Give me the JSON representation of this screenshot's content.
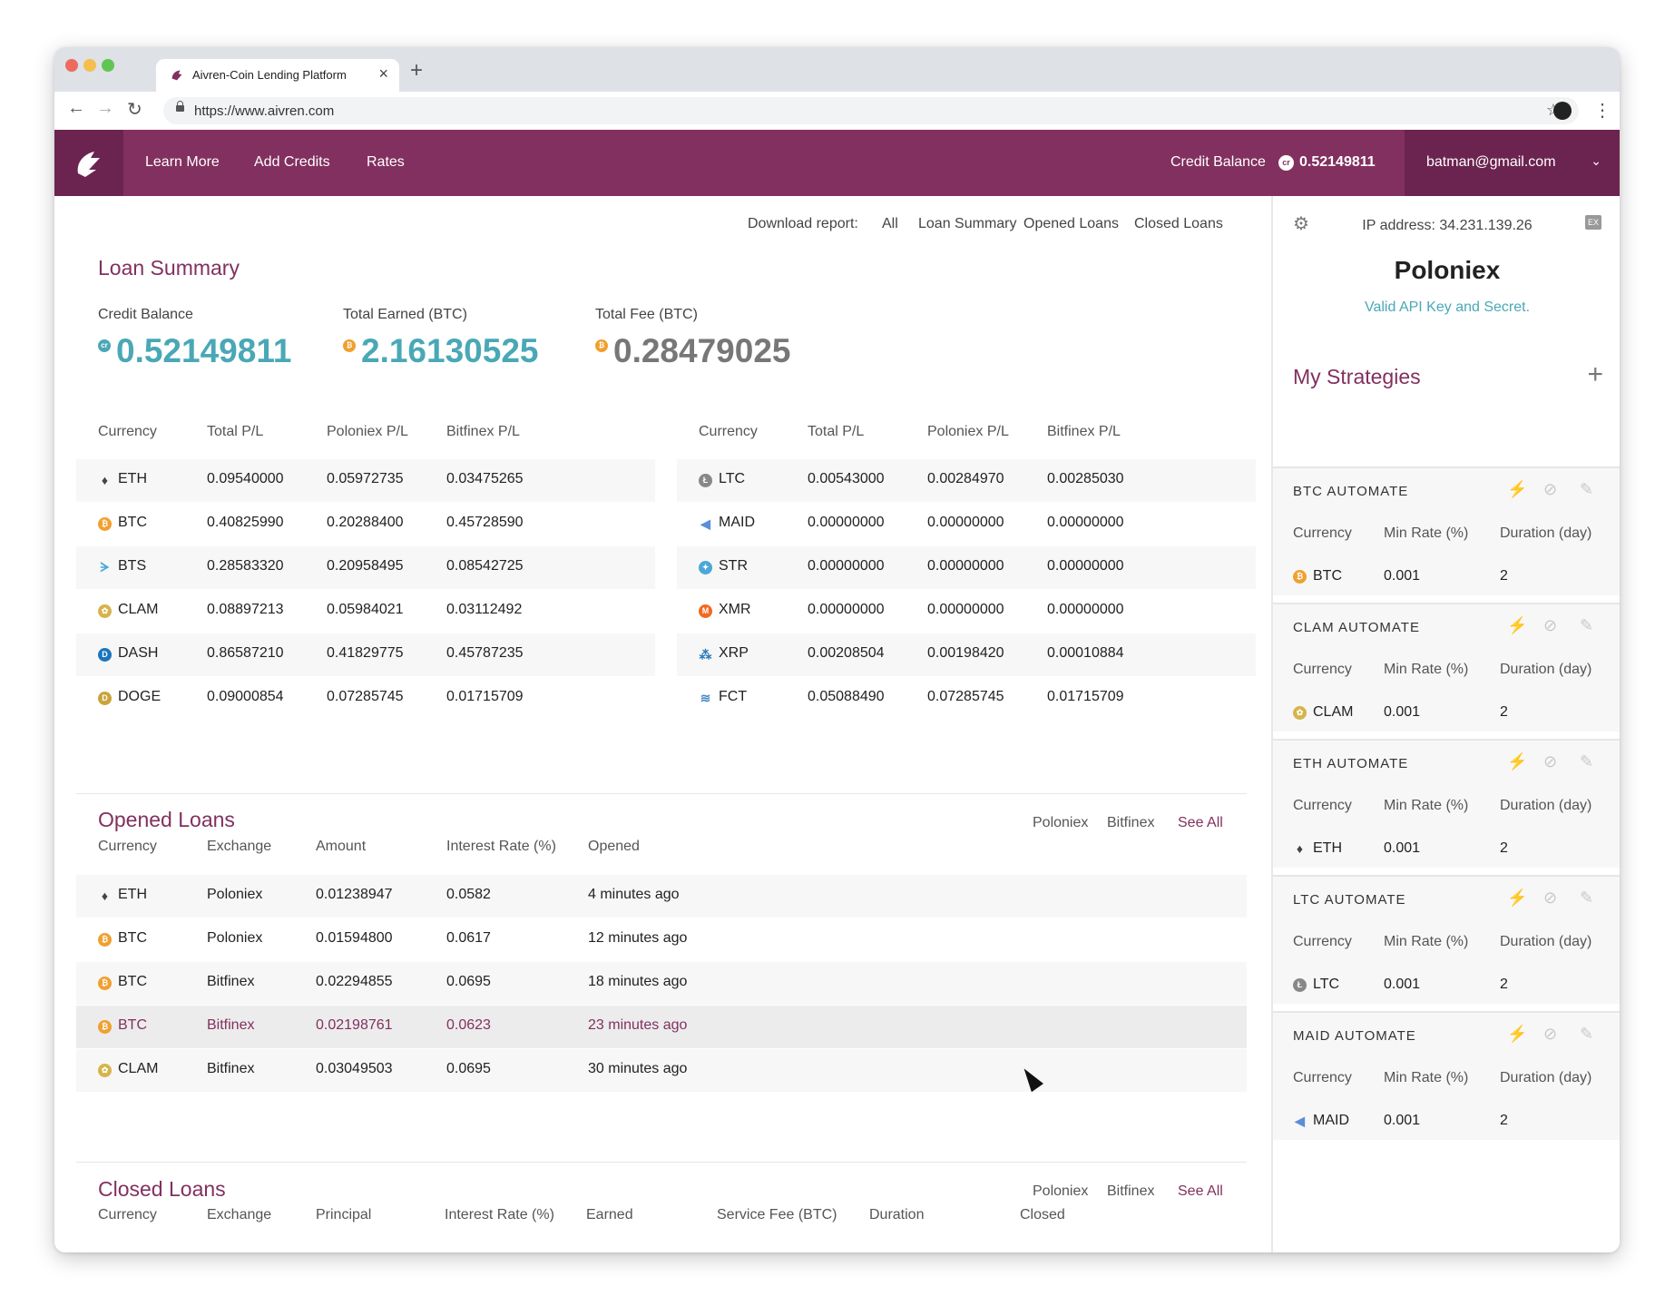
{
  "browser": {
    "tab_title": "Aivren-Coin Lending Platform",
    "tab_close": "×",
    "new_tab": "+",
    "url": "https://www.aivren.com",
    "back": "←",
    "forward": "→",
    "reload": "↻",
    "bookmark": "☆",
    "menu": "⋮"
  },
  "colors": {
    "brand": "#82305f",
    "brand_dark": "#6b2450",
    "teal": "#4aa8b6",
    "btc": "#f0a030",
    "lightning": "#f0a030"
  },
  "header": {
    "nav": [
      "Learn More",
      "Add Credits",
      "Rates"
    ],
    "credit_label": "Credit Balance",
    "credit_icon": "cr",
    "credit_value": "0.52149811",
    "user_email": "batman@gmail.com",
    "caret": "⌄"
  },
  "download": {
    "label": "Download report:",
    "options": [
      "All",
      "Loan Summary",
      "Opened Loans",
      "Closed Loans"
    ]
  },
  "loan_summary": {
    "title": "Loan Summary",
    "stats": [
      {
        "label": "Credit Balance",
        "value": "0.52149811",
        "icon": "cr",
        "color": "#4aa8b6"
      },
      {
        "label": "Total Earned (BTC)",
        "value": "2.16130525",
        "icon": "₿",
        "color": "#4aa8b6"
      },
      {
        "label": "Total Fee (BTC)",
        "value": "0.28479025",
        "icon": "₿",
        "color": "#777777"
      }
    ],
    "headers": [
      "Currency",
      "Total P/L",
      "Poloniex P/L",
      "Bitfinex P/L"
    ],
    "left_rows": [
      {
        "currency": "ETH",
        "icon": "eth-icon",
        "total": "0.09540000",
        "poloniex": "0.05972735",
        "bitfinex": "0.03475265"
      },
      {
        "currency": "BTC",
        "icon": "btc-icon",
        "total": "0.40825990",
        "poloniex": "0.20288400",
        "bitfinex": "0.45728590"
      },
      {
        "currency": "BTS",
        "icon": "bts-icon",
        "total": "0.28583320",
        "poloniex": "0.20958495",
        "bitfinex": "0.08542725"
      },
      {
        "currency": "CLAM",
        "icon": "clam-icon",
        "total": "0.08897213",
        "poloniex": "0.05984021",
        "bitfinex": "0.03112492"
      },
      {
        "currency": "DASH",
        "icon": "dash-icon",
        "total": "0.86587210",
        "poloniex": "0.41829775",
        "bitfinex": "0.45787235"
      },
      {
        "currency": "DOGE",
        "icon": "doge-icon",
        "total": "0.09000854",
        "poloniex": "0.07285745",
        "bitfinex": "0.01715709"
      }
    ],
    "right_rows": [
      {
        "currency": "LTC",
        "icon": "ltc-icon",
        "total": "0.00543000",
        "poloniex": "0.00284970",
        "bitfinex": "0.00285030"
      },
      {
        "currency": "MAID",
        "icon": "maid-icon",
        "total": "0.00000000",
        "poloniex": "0.00000000",
        "bitfinex": "0.00000000"
      },
      {
        "currency": "STR",
        "icon": "str-icon",
        "total": "0.00000000",
        "poloniex": "0.00000000",
        "bitfinex": "0.00000000"
      },
      {
        "currency": "XMR",
        "icon": "xmr-icon",
        "total": "0.00000000",
        "poloniex": "0.00000000",
        "bitfinex": "0.00000000"
      },
      {
        "currency": "XRP",
        "icon": "xrp-icon",
        "total": "0.00208504",
        "poloniex": "0.00198420",
        "bitfinex": "0.00010884"
      },
      {
        "currency": "FCT",
        "icon": "fct-icon",
        "total": "0.05088490",
        "poloniex": "0.07285745",
        "bitfinex": "0.01715709"
      }
    ]
  },
  "opened_loans": {
    "title": "Opened Loans",
    "filters": [
      "Poloniex",
      "Bitfinex",
      "See All"
    ],
    "headers": [
      "Currency",
      "Exchange",
      "Amount",
      "Interest Rate (%)",
      "Opened"
    ],
    "rows": [
      {
        "currency": "ETH",
        "icon": "eth-icon",
        "exchange": "Poloniex",
        "amount": "0.01238947",
        "rate": "0.0582",
        "opened": "4 minutes ago"
      },
      {
        "currency": "BTC",
        "icon": "btc-icon",
        "exchange": "Poloniex",
        "amount": "0.01594800",
        "rate": "0.0617",
        "opened": "12 minutes ago"
      },
      {
        "currency": "BTC",
        "icon": "btc-icon",
        "exchange": "Bitfinex",
        "amount": "0.02294855",
        "rate": "0.0695",
        "opened": "18 minutes ago"
      },
      {
        "currency": "BTC",
        "icon": "btc-icon",
        "exchange": "Bitfinex",
        "amount": "0.02198761",
        "rate": "0.0623",
        "opened": "23 minutes ago"
      },
      {
        "currency": "CLAM",
        "icon": "clam-icon",
        "exchange": "Bitfinex",
        "amount": "0.03049503",
        "rate": "0.0695",
        "opened": "30 minutes ago"
      }
    ]
  },
  "closed_loans": {
    "title": "Closed Loans",
    "filters": [
      "Poloniex",
      "Bitfinex",
      "See All"
    ],
    "headers": [
      "Currency",
      "Exchange",
      "Principal",
      "Interest Rate (%)",
      "Earned",
      "Service Fee (BTC)",
      "Duration",
      "Closed"
    ]
  },
  "sidebar": {
    "ip": "IP address: 34.231.139.26",
    "exit_icon": "EX",
    "exchange": "Poloniex",
    "status": "Valid API Key and Secret.",
    "strategies_title": "My Strategies",
    "add": "+",
    "strategy_headers": [
      "Currency",
      "Min Rate (%)",
      "Duration (day)"
    ],
    "strategies": [
      {
        "name": "BTC AUTOMATE",
        "currency": "BTC",
        "icon": "btc-icon",
        "min_rate": "0.001",
        "duration": "2",
        "active": true
      },
      {
        "name": "CLAM AUTOMATE",
        "currency": "CLAM",
        "icon": "clam-icon",
        "min_rate": "0.001",
        "duration": "2",
        "active": true
      },
      {
        "name": "ETH AUTOMATE",
        "currency": "ETH",
        "icon": "eth-icon",
        "min_rate": "0.001",
        "duration": "2",
        "active": true
      },
      {
        "name": "LTC AUTOMATE",
        "currency": "LTC",
        "icon": "ltc-icon",
        "min_rate": "0.001",
        "duration": "2",
        "active": false
      },
      {
        "name": "MAID AUTOMATE",
        "currency": "MAID",
        "icon": "maid-icon",
        "min_rate": "0.001",
        "duration": "2",
        "active": false
      }
    ]
  }
}
